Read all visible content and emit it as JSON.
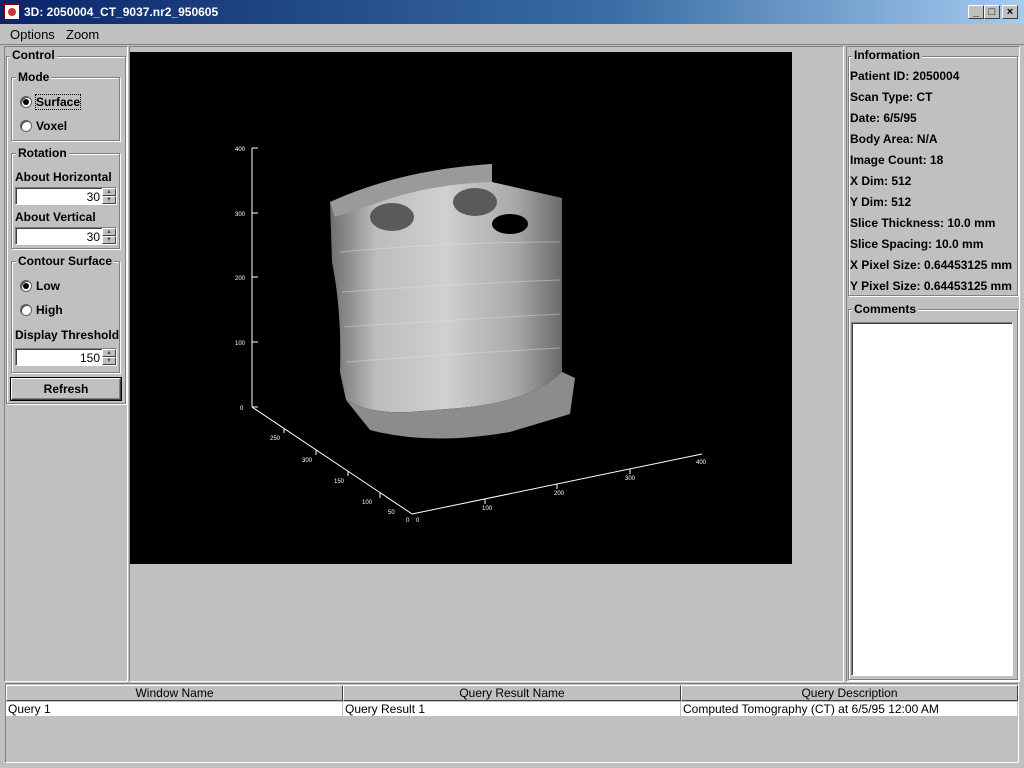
{
  "window": {
    "title": "3D: 2050004_CT_9037.nr2_950605",
    "minimize": "_",
    "maximize": "□",
    "close": "×"
  },
  "menu": {
    "options": "Options",
    "zoom": "Zoom"
  },
  "control": {
    "title": "Control",
    "mode": {
      "title": "Mode",
      "options": [
        "Surface",
        "Voxel"
      ],
      "selected": "Surface"
    },
    "rotation": {
      "title": "Rotation",
      "horizontal_label": "About Horizontal",
      "horizontal_value": "30",
      "vertical_label": "About Vertical",
      "vertical_value": "30"
    },
    "contour": {
      "title": "Contour Surface",
      "options": [
        "Low",
        "High"
      ],
      "selected": "Low",
      "threshold_label": "Display Threshold",
      "threshold_value": "150"
    },
    "refresh_label": "Refresh"
  },
  "render": {
    "z_ticks": [
      "400",
      "300",
      "200",
      "100",
      "0"
    ],
    "y_ticks": [
      "250",
      "300",
      "150",
      "100",
      "50",
      "0"
    ],
    "x_ticks": [
      "0",
      "100",
      "200",
      "300",
      "400"
    ]
  },
  "information": {
    "title": "Information",
    "lines": [
      "Patient ID: 2050004",
      "Scan Type: CT",
      "Date: 6/5/95",
      "Body Area: N/A",
      "Image Count: 18",
      "X Dim: 512",
      "Y Dim: 512",
      "Slice Thickness: 10.0 mm",
      "Slice Spacing: 10.0 mm",
      "X Pixel Size: 0.64453125 mm",
      "Y Pixel Size: 0.64453125 mm"
    ]
  },
  "comments": {
    "title": "Comments",
    "text": ""
  },
  "table": {
    "headers": [
      "Window Name",
      "Query Result Name",
      "Query Description"
    ],
    "rows": [
      [
        "Query 1",
        "Query Result 1",
        "Computed Tomography (CT) at 6/5/95 12:00 AM"
      ]
    ]
  },
  "colors": {
    "title_bar": "#0a246a",
    "background": "#c0c0c0",
    "viewport": "#000000"
  }
}
